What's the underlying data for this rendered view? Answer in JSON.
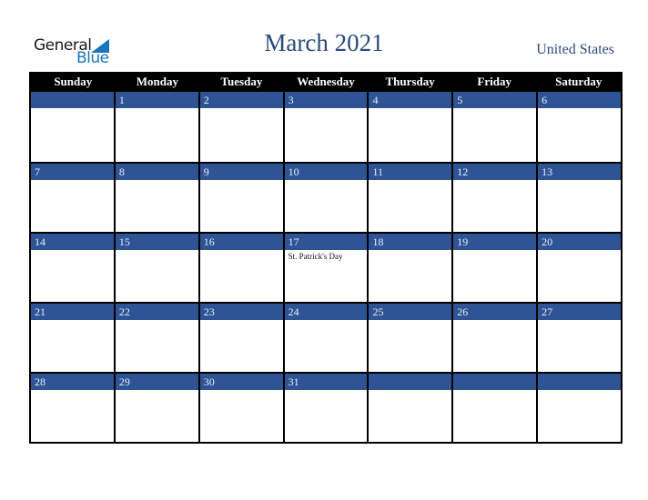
{
  "logo": {
    "line1": "General",
    "line2": "Blue"
  },
  "title": "March 2021",
  "country": "United States",
  "colors": {
    "header_bg": "#000000",
    "daynum_bg": "#2e5496",
    "title": "#2a4a7a",
    "logo_blue": "#1a75bc"
  },
  "weekdays": [
    "Sunday",
    "Monday",
    "Tuesday",
    "Wednesday",
    "Thursday",
    "Friday",
    "Saturday"
  ],
  "weeks": [
    [
      {
        "day": ""
      },
      {
        "day": "1"
      },
      {
        "day": "2"
      },
      {
        "day": "3"
      },
      {
        "day": "4"
      },
      {
        "day": "5"
      },
      {
        "day": "6"
      }
    ],
    [
      {
        "day": "7"
      },
      {
        "day": "8"
      },
      {
        "day": "9"
      },
      {
        "day": "10"
      },
      {
        "day": "11"
      },
      {
        "day": "12"
      },
      {
        "day": "13"
      }
    ],
    [
      {
        "day": "14"
      },
      {
        "day": "15"
      },
      {
        "day": "16"
      },
      {
        "day": "17",
        "event": "St. Patrick's Day"
      },
      {
        "day": "18"
      },
      {
        "day": "19"
      },
      {
        "day": "20"
      }
    ],
    [
      {
        "day": "21"
      },
      {
        "day": "22"
      },
      {
        "day": "23"
      },
      {
        "day": "24"
      },
      {
        "day": "25"
      },
      {
        "day": "26"
      },
      {
        "day": "27"
      }
    ],
    [
      {
        "day": "28"
      },
      {
        "day": "29"
      },
      {
        "day": "30"
      },
      {
        "day": "31"
      },
      {
        "day": ""
      },
      {
        "day": ""
      },
      {
        "day": ""
      }
    ]
  ]
}
